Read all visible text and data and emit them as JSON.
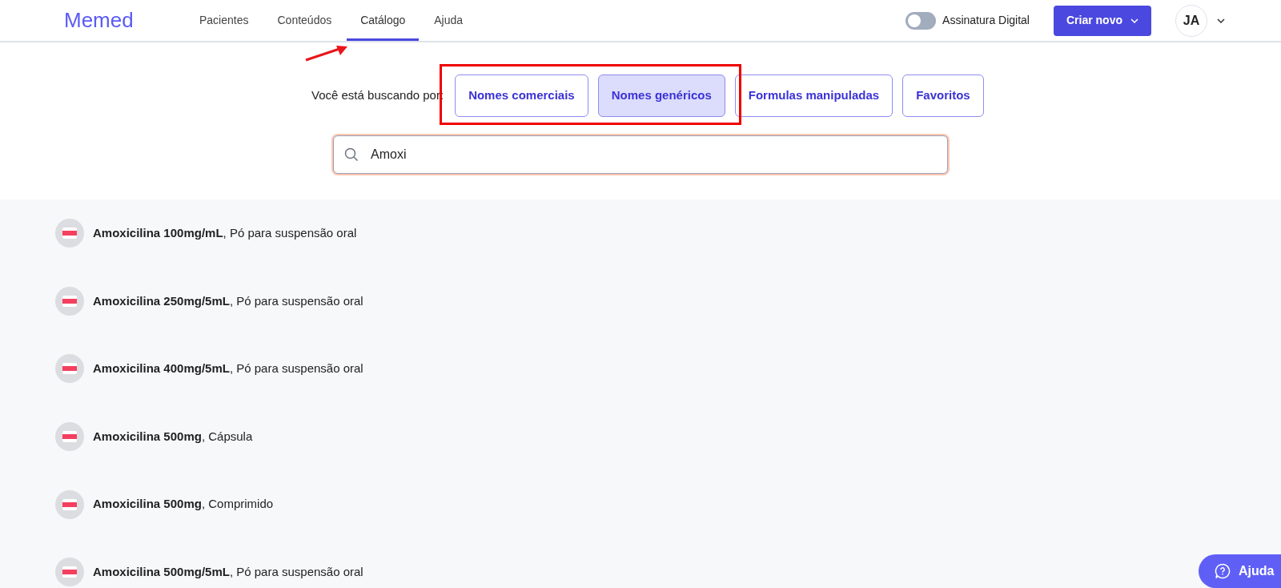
{
  "header": {
    "logo": "Memed",
    "nav": [
      {
        "label": "Pacientes",
        "selected": false
      },
      {
        "label": "Conteúdos",
        "selected": false
      },
      {
        "label": "Catálogo",
        "selected": true
      },
      {
        "label": "Ajuda",
        "selected": false
      }
    ],
    "signature_toggle": {
      "label": "Assinatura Digital",
      "on": false
    },
    "create_button": "Criar novo",
    "avatar": "JA"
  },
  "search_by": {
    "label": "Você está buscando por:",
    "options": [
      {
        "label": "Nomes comerciais",
        "selected": false
      },
      {
        "label": "Nomes genéricos",
        "selected": true
      },
      {
        "label": "Formulas manipuladas",
        "selected": false
      },
      {
        "label": "Favoritos",
        "selected": false
      }
    ]
  },
  "search": {
    "value": "Amoxi"
  },
  "results": [
    {
      "name": "Amoxicilina 100mg/mL",
      "form": ", Pó para suspensão oral"
    },
    {
      "name": "Amoxicilina 250mg/5mL",
      "form": ", Pó para suspensão oral"
    },
    {
      "name": "Amoxicilina 400mg/5mL",
      "form": ", Pó para suspensão oral"
    },
    {
      "name": "Amoxicilina 500mg",
      "form": ", Cápsula"
    },
    {
      "name": "Amoxicilina 500mg",
      "form": ", Comprimido"
    },
    {
      "name": "Amoxicilina 500mg/5mL",
      "form": ", Pó para suspensão oral"
    }
  ],
  "help_button": "Ajuda"
}
